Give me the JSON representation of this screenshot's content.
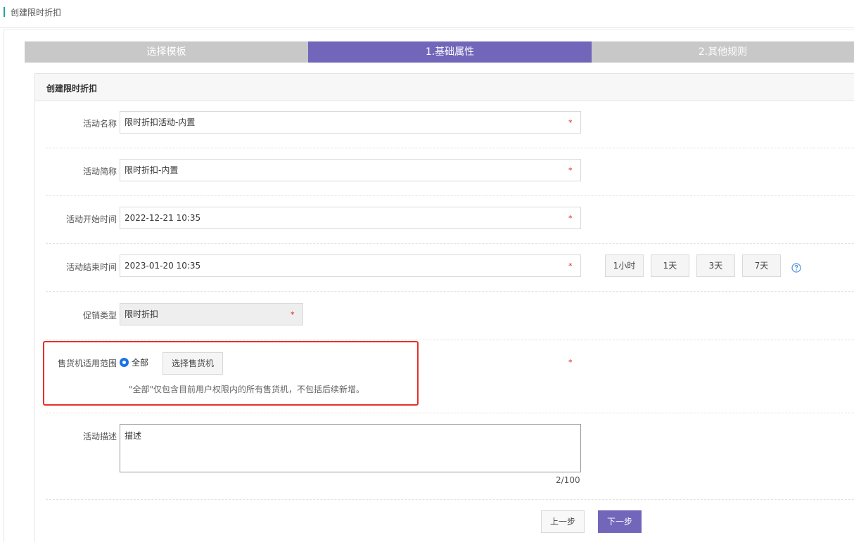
{
  "page": {
    "title": "创建限时折扣"
  },
  "steps": [
    {
      "label": "选择模板"
    },
    {
      "label": "1.基础属性"
    },
    {
      "label": "2.其他规则"
    }
  ],
  "card": {
    "title": "创建限时折扣"
  },
  "form": {
    "name": {
      "label": "活动名称",
      "value": "限时折扣活动-内置",
      "required_mark": "*"
    },
    "short_name": {
      "label": "活动简称",
      "value": "限时折扣-内置",
      "required_mark": "*"
    },
    "start_time": {
      "label": "活动开始时间",
      "value": "2022-12-21 10:35",
      "required_mark": "*"
    },
    "end_time": {
      "label": "活动结束时间",
      "value": "2023-01-20 10:35",
      "required_mark": "*"
    },
    "quick_durations": [
      "1小时",
      "1天",
      "3天",
      "7天"
    ],
    "promo_type": {
      "label": "促销类型",
      "value": "限时折扣",
      "required_mark": "*"
    },
    "scope": {
      "label": "售货机适用范围",
      "radio_label": "全部",
      "select_button": "选择售货机",
      "hint": "\"全部\"仅包含目前用户权限内的所有售货机，不包括后续新增。",
      "required_mark": "*"
    },
    "description": {
      "label": "活动描述",
      "value": "描述",
      "counter": "2/100"
    }
  },
  "actions": {
    "prev": "上一步",
    "next": "下一步"
  },
  "colors": {
    "accent": "#7266ba",
    "required": "#e02020",
    "highlight": "#e5302b",
    "header_bar": "#1aa8a0"
  }
}
